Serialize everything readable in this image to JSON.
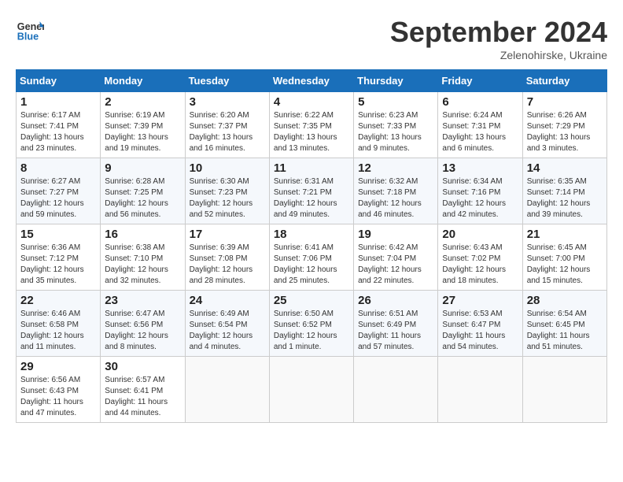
{
  "header": {
    "logo_line1": "General",
    "logo_line2": "Blue",
    "month": "September 2024",
    "location": "Zelenohirske, Ukraine"
  },
  "days_of_week": [
    "Sunday",
    "Monday",
    "Tuesday",
    "Wednesday",
    "Thursday",
    "Friday",
    "Saturday"
  ],
  "weeks": [
    [
      {
        "day": "1",
        "sunrise": "6:17 AM",
        "sunset": "7:41 PM",
        "daylight": "13 hours and 23 minutes."
      },
      {
        "day": "2",
        "sunrise": "6:19 AM",
        "sunset": "7:39 PM",
        "daylight": "13 hours and 19 minutes."
      },
      {
        "day": "3",
        "sunrise": "6:20 AM",
        "sunset": "7:37 PM",
        "daylight": "13 hours and 16 minutes."
      },
      {
        "day": "4",
        "sunrise": "6:22 AM",
        "sunset": "7:35 PM",
        "daylight": "13 hours and 13 minutes."
      },
      {
        "day": "5",
        "sunrise": "6:23 AM",
        "sunset": "7:33 PM",
        "daylight": "13 hours and 9 minutes."
      },
      {
        "day": "6",
        "sunrise": "6:24 AM",
        "sunset": "7:31 PM",
        "daylight": "13 hours and 6 minutes."
      },
      {
        "day": "7",
        "sunrise": "6:26 AM",
        "sunset": "7:29 PM",
        "daylight": "13 hours and 3 minutes."
      }
    ],
    [
      {
        "day": "8",
        "sunrise": "6:27 AM",
        "sunset": "7:27 PM",
        "daylight": "12 hours and 59 minutes."
      },
      {
        "day": "9",
        "sunrise": "6:28 AM",
        "sunset": "7:25 PM",
        "daylight": "12 hours and 56 minutes."
      },
      {
        "day": "10",
        "sunrise": "6:30 AM",
        "sunset": "7:23 PM",
        "daylight": "12 hours and 52 minutes."
      },
      {
        "day": "11",
        "sunrise": "6:31 AM",
        "sunset": "7:21 PM",
        "daylight": "12 hours and 49 minutes."
      },
      {
        "day": "12",
        "sunrise": "6:32 AM",
        "sunset": "7:18 PM",
        "daylight": "12 hours and 46 minutes."
      },
      {
        "day": "13",
        "sunrise": "6:34 AM",
        "sunset": "7:16 PM",
        "daylight": "12 hours and 42 minutes."
      },
      {
        "day": "14",
        "sunrise": "6:35 AM",
        "sunset": "7:14 PM",
        "daylight": "12 hours and 39 minutes."
      }
    ],
    [
      {
        "day": "15",
        "sunrise": "6:36 AM",
        "sunset": "7:12 PM",
        "daylight": "12 hours and 35 minutes."
      },
      {
        "day": "16",
        "sunrise": "6:38 AM",
        "sunset": "7:10 PM",
        "daylight": "12 hours and 32 minutes."
      },
      {
        "day": "17",
        "sunrise": "6:39 AM",
        "sunset": "7:08 PM",
        "daylight": "12 hours and 28 minutes."
      },
      {
        "day": "18",
        "sunrise": "6:41 AM",
        "sunset": "7:06 PM",
        "daylight": "12 hours and 25 minutes."
      },
      {
        "day": "19",
        "sunrise": "6:42 AM",
        "sunset": "7:04 PM",
        "daylight": "12 hours and 22 minutes."
      },
      {
        "day": "20",
        "sunrise": "6:43 AM",
        "sunset": "7:02 PM",
        "daylight": "12 hours and 18 minutes."
      },
      {
        "day": "21",
        "sunrise": "6:45 AM",
        "sunset": "7:00 PM",
        "daylight": "12 hours and 15 minutes."
      }
    ],
    [
      {
        "day": "22",
        "sunrise": "6:46 AM",
        "sunset": "6:58 PM",
        "daylight": "12 hours and 11 minutes."
      },
      {
        "day": "23",
        "sunrise": "6:47 AM",
        "sunset": "6:56 PM",
        "daylight": "12 hours and 8 minutes."
      },
      {
        "day": "24",
        "sunrise": "6:49 AM",
        "sunset": "6:54 PM",
        "daylight": "12 hours and 4 minutes."
      },
      {
        "day": "25",
        "sunrise": "6:50 AM",
        "sunset": "6:52 PM",
        "daylight": "12 hours and 1 minute."
      },
      {
        "day": "26",
        "sunrise": "6:51 AM",
        "sunset": "6:49 PM",
        "daylight": "11 hours and 57 minutes."
      },
      {
        "day": "27",
        "sunrise": "6:53 AM",
        "sunset": "6:47 PM",
        "daylight": "11 hours and 54 minutes."
      },
      {
        "day": "28",
        "sunrise": "6:54 AM",
        "sunset": "6:45 PM",
        "daylight": "11 hours and 51 minutes."
      }
    ],
    [
      {
        "day": "29",
        "sunrise": "6:56 AM",
        "sunset": "6:43 PM",
        "daylight": "11 hours and 47 minutes."
      },
      {
        "day": "30",
        "sunrise": "6:57 AM",
        "sunset": "6:41 PM",
        "daylight": "11 hours and 44 minutes."
      },
      null,
      null,
      null,
      null,
      null
    ]
  ]
}
